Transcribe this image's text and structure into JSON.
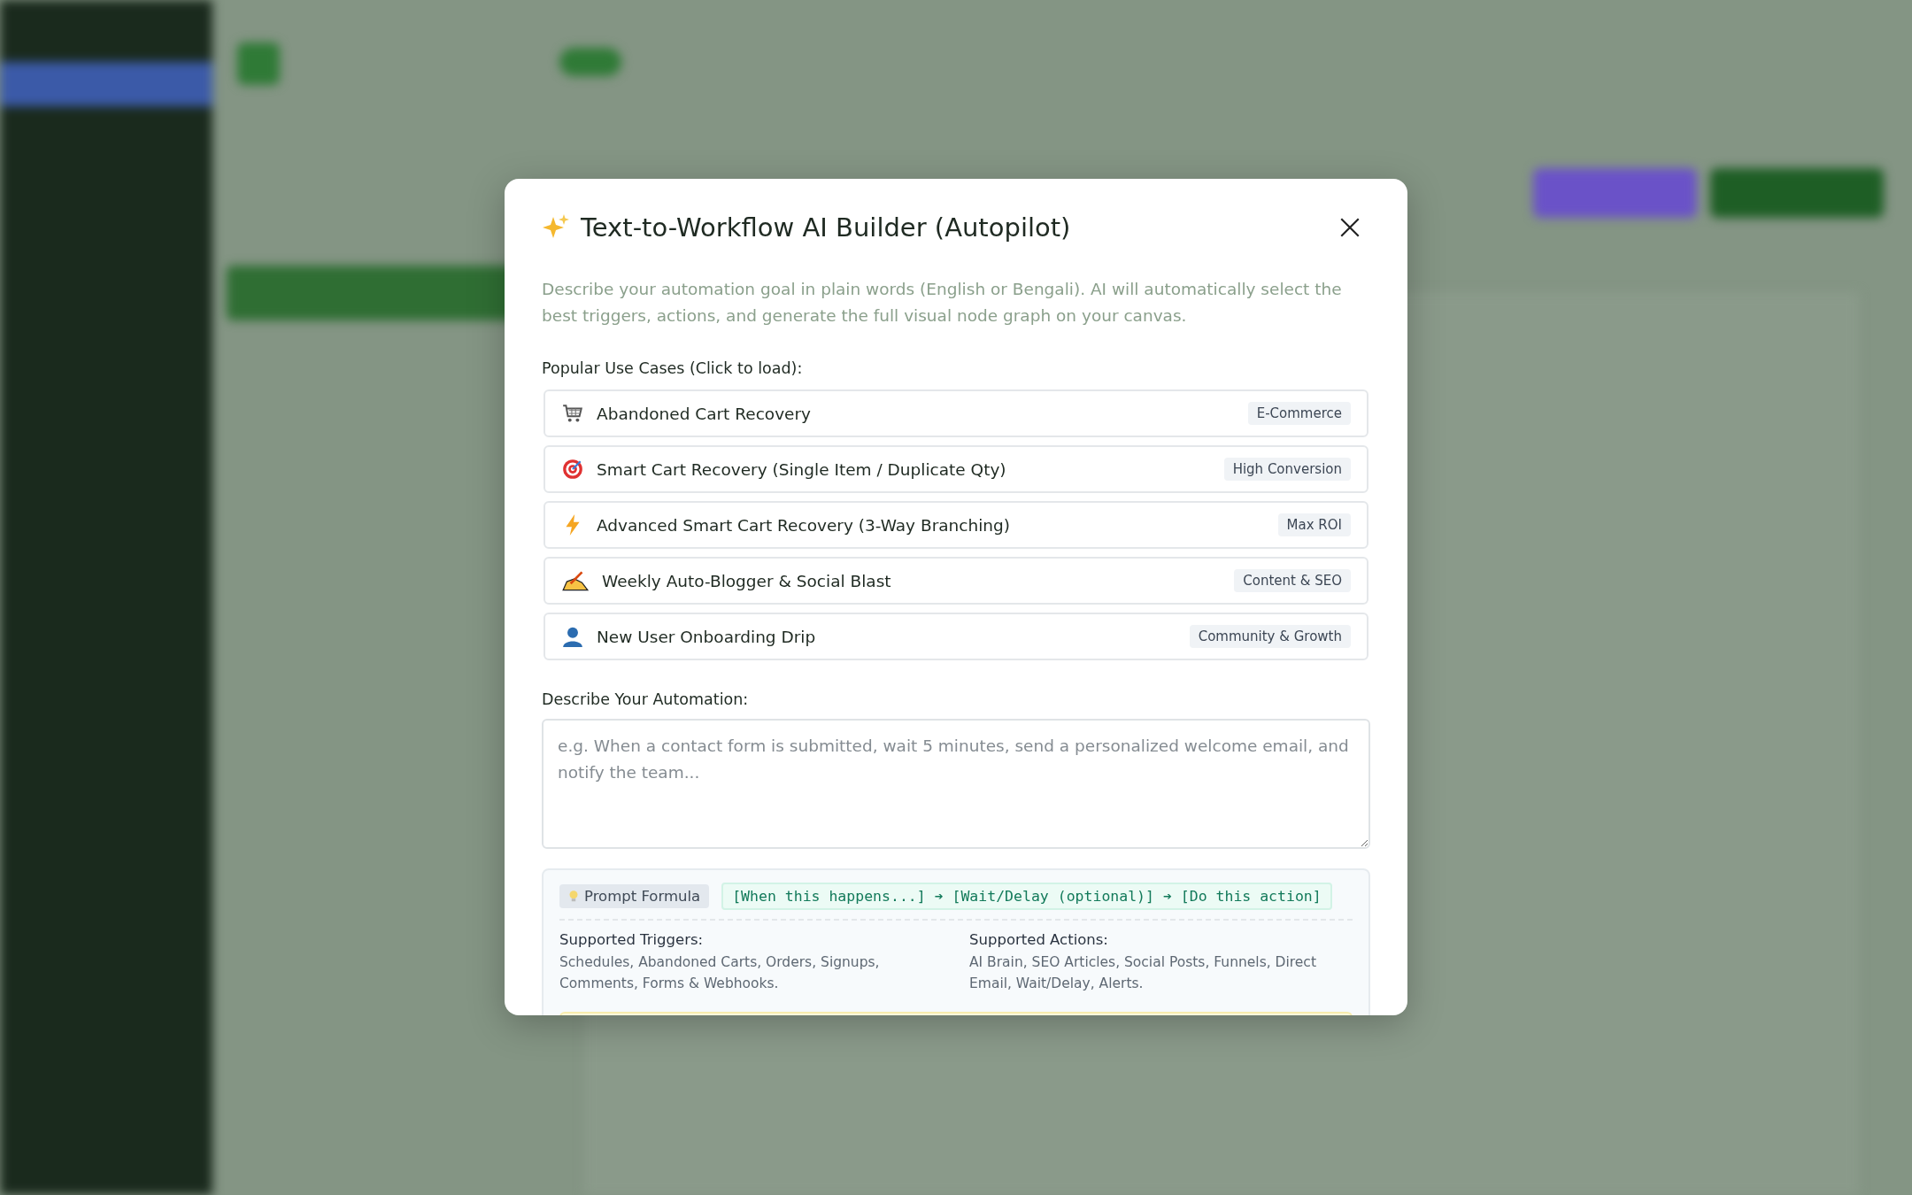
{
  "modal": {
    "title": "Text-to-Workflow AI Builder (Autopilot)",
    "description": "Describe your automation goal in plain words (English or Bengali). AI will automatically select the best triggers, actions, and generate the full visual node graph on your canvas.",
    "use_cases_label": "Popular Use Cases (Click to load):",
    "use_cases": [
      {
        "kind": "cart",
        "label": "Abandoned Cart Recovery",
        "tag": "E-Commerce"
      },
      {
        "kind": "target",
        "label": "Smart Cart Recovery (Single Item / Duplicate Qty)",
        "tag": "High Conversion"
      },
      {
        "kind": "bolt",
        "label": "Advanced Smart Cart Recovery (3-Way Branching)",
        "tag": "Max ROI"
      },
      {
        "kind": "writing",
        "label": "Weekly Auto-Blogger & Social Blast",
        "tag": "Content & SEO"
      },
      {
        "kind": "person",
        "label": "New User Onboarding Drip",
        "tag": "Community & Growth"
      }
    ],
    "automation_label": "Describe Your Automation:",
    "automation_field": {
      "placeholder": "e.g. When a contact form is submitted, wait 5 minutes, send a personalized welcome email, and notify the team..."
    },
    "formula": {
      "badge": "Prompt Formula",
      "text": "[When this happens...] ➔ [Wait/Delay (optional)] ➔ [Do this action]",
      "triggers_label": "Supported Triggers:",
      "triggers": "Schedules, Abandoned Carts, Orders, Signups, Comments, Forms & Webhooks.",
      "actions_label": "Supported Actions:",
      "actions": "AI Brain, SEO Articles, Social Posts, Funnels, Direct Email, Wait/Delay, Alerts."
    }
  }
}
